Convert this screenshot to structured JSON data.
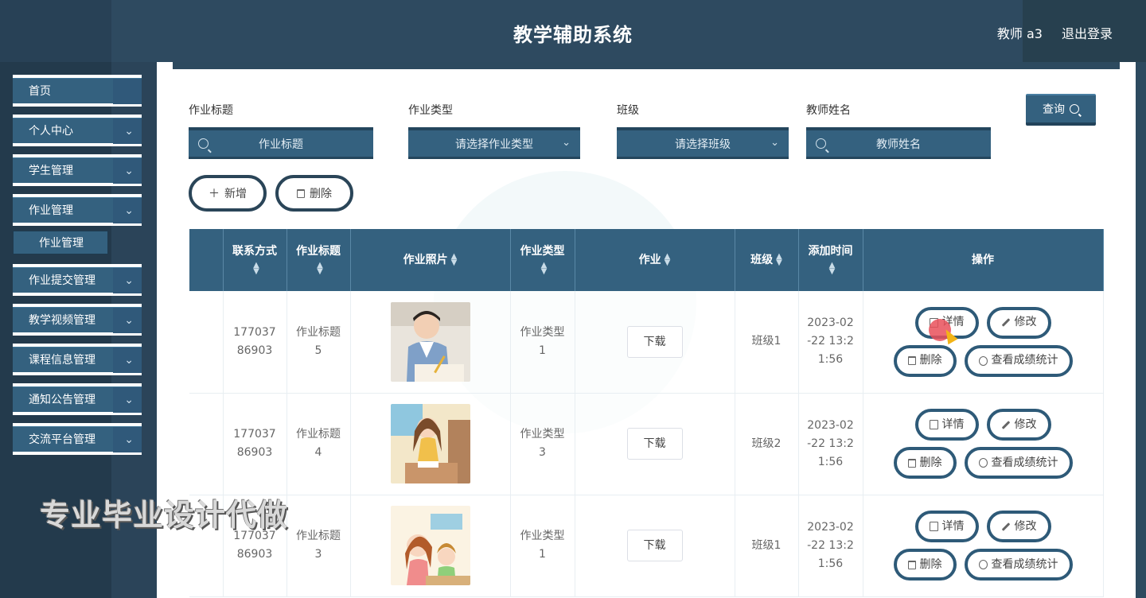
{
  "header": {
    "title": "教学辅助系统",
    "user": "教师 a3",
    "logout": "退出登录"
  },
  "sidebar": {
    "items": [
      {
        "label": "首页",
        "chevron": false
      },
      {
        "label": "个人中心",
        "chevron": true
      },
      {
        "label": "学生管理",
        "chevron": true
      },
      {
        "label": "作业管理",
        "chevron": true
      },
      {
        "label": "作业提交管理",
        "chevron": true
      },
      {
        "label": "教学视频管理",
        "chevron": true
      },
      {
        "label": "课程信息管理",
        "chevron": true
      },
      {
        "label": "通知公告管理",
        "chevron": true
      },
      {
        "label": "交流平台管理",
        "chevron": true
      }
    ],
    "sub_active": "作业管理"
  },
  "watermark": "专业毕业设计代做",
  "search": {
    "title_label": "作业标题",
    "title_placeholder": "作业标题",
    "type_label": "作业类型",
    "type_placeholder": "请选择作业类型",
    "class_label": "班级",
    "class_placeholder": "请选择班级",
    "teacher_label": "教师姓名",
    "teacher_placeholder": "教师姓名",
    "query": "查询"
  },
  "actions": {
    "add": "新增",
    "delete": "删除"
  },
  "table": {
    "headers": [
      "联系方式",
      "作业标题",
      "作业照片",
      "作业类型",
      "作业",
      "班级",
      "添加时间",
      "操作"
    ],
    "rows": [
      {
        "phone": "17703786903",
        "title": "作业标题5",
        "type": "作业类型1",
        "download": "下载",
        "class": "班级1",
        "time": "2023-02-22 13:21:56"
      },
      {
        "phone": "17703786903",
        "title": "作业标题4",
        "type": "作业类型3",
        "download": "下载",
        "class": "班级2",
        "time": "2023-02-22 13:21:56"
      },
      {
        "phone": "17703786903",
        "title": "作业标题3",
        "type": "作业类型1",
        "download": "下载",
        "class": "班级1",
        "time": "2023-02-22 13:21:56"
      }
    ],
    "op_labels": {
      "detail": "详情",
      "edit": "修改",
      "delete": "删除",
      "stats": "查看成绩统计"
    }
  },
  "colors": {
    "primary": "#34617f",
    "header": "#2e4a60",
    "border_dark": "#2a4558"
  },
  "icons": [
    "search-icon",
    "chevron-down-icon",
    "plus-icon",
    "trash-icon",
    "document-icon",
    "pen-icon",
    "pie-chart-icon"
  ]
}
